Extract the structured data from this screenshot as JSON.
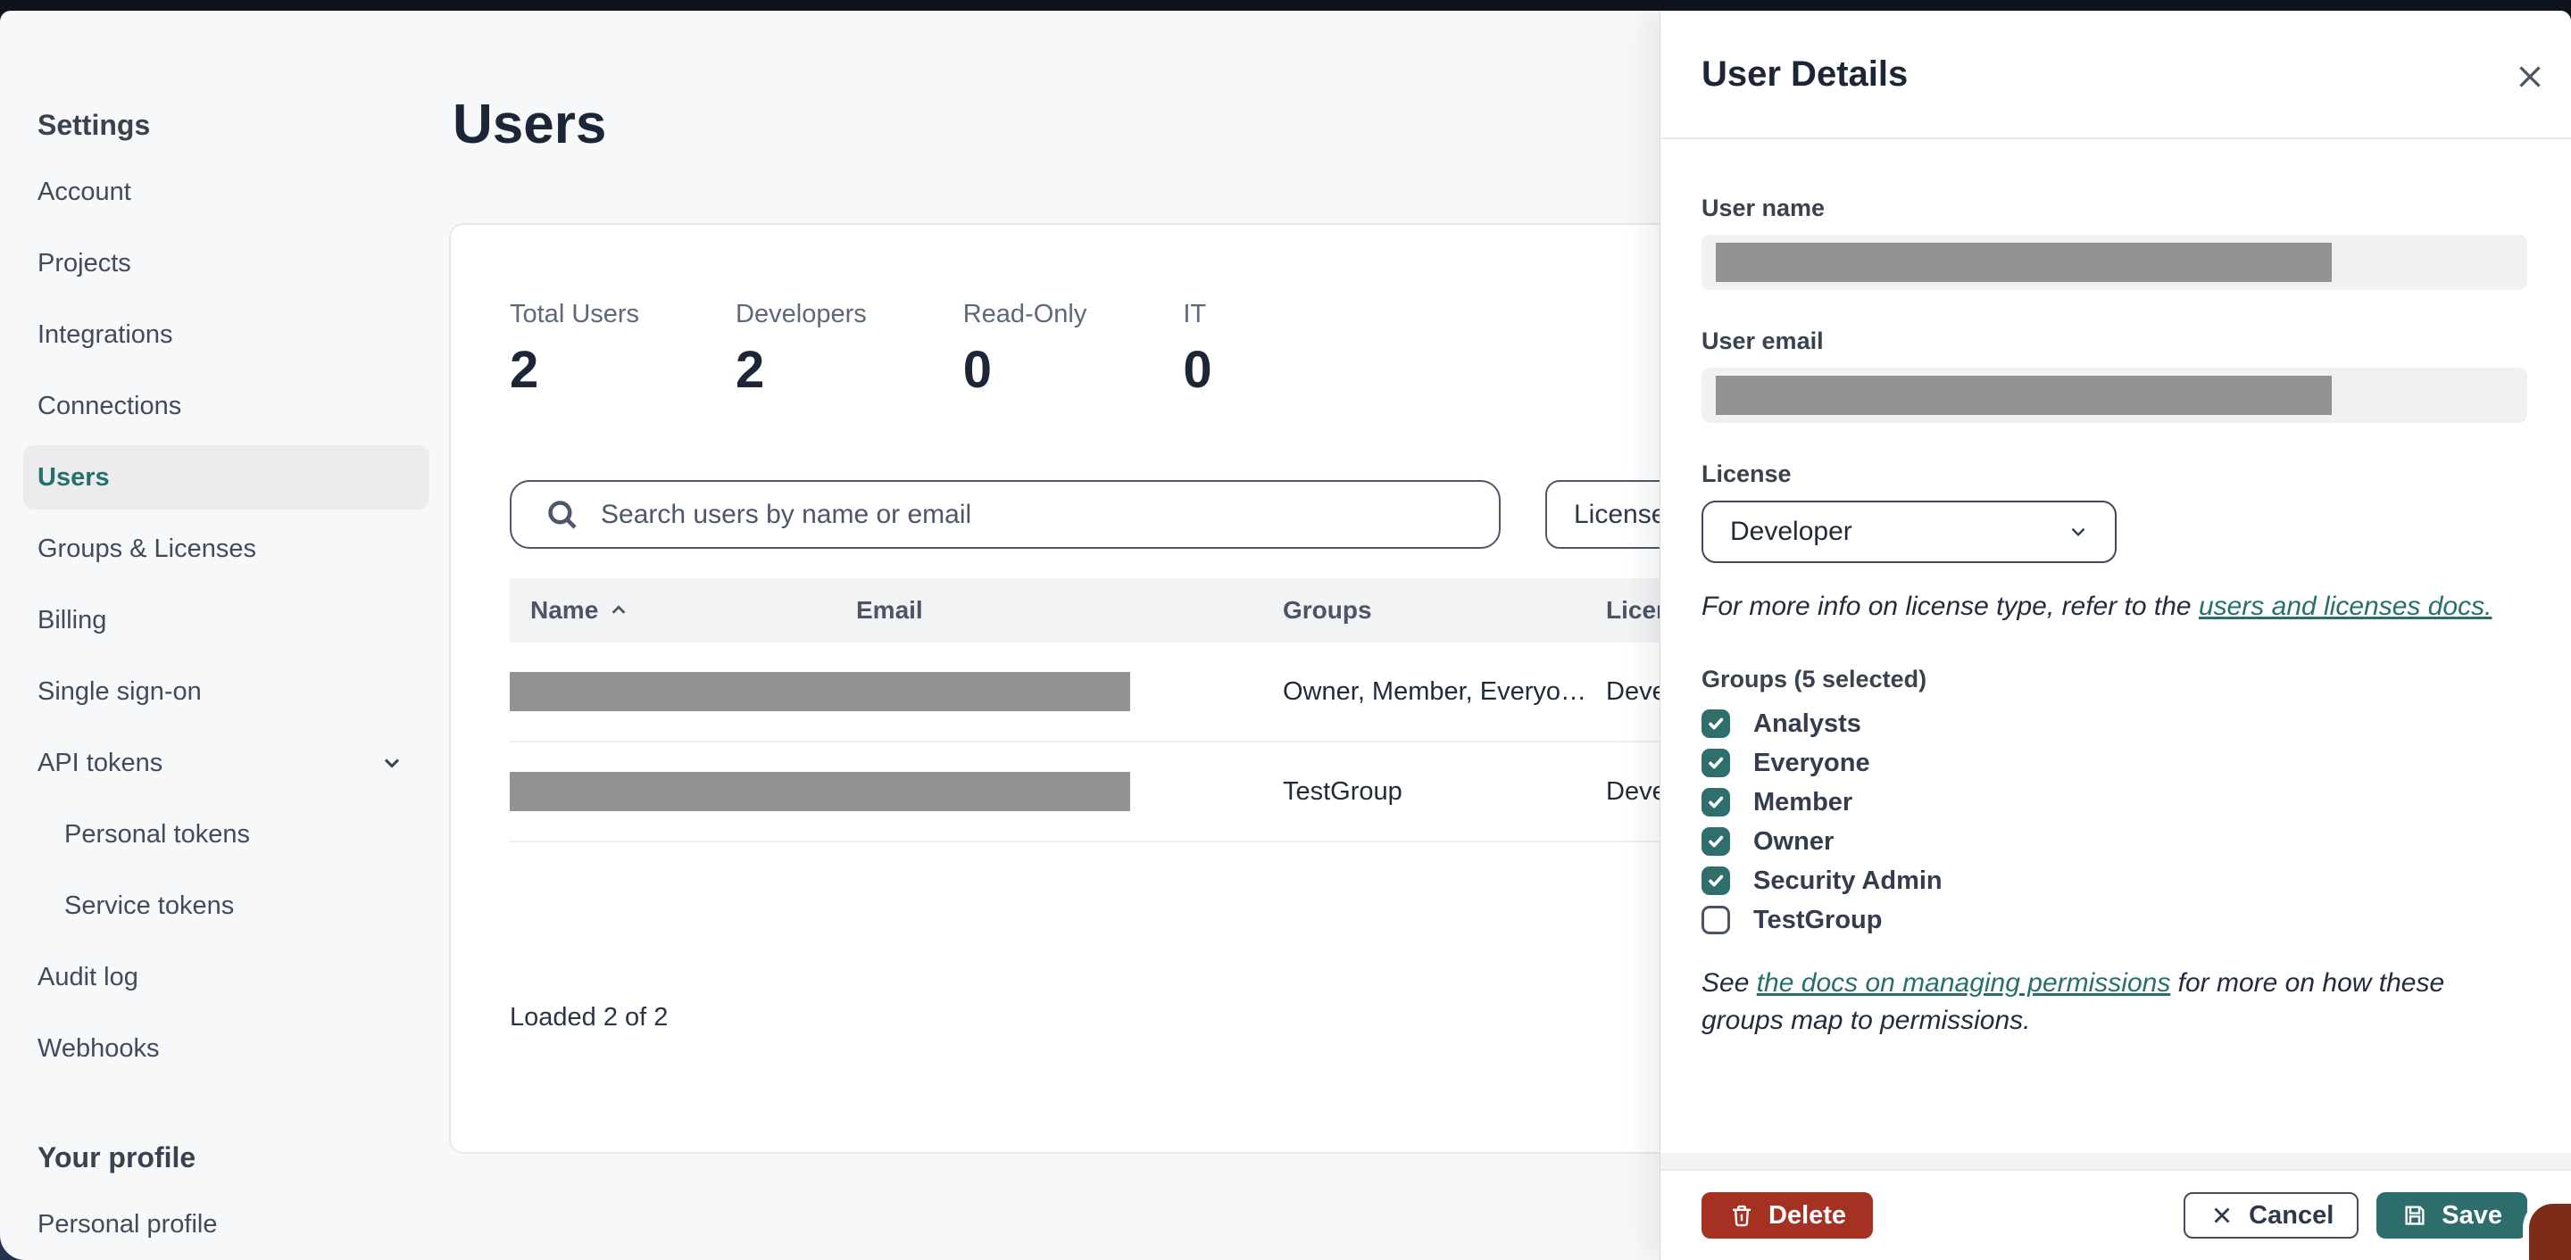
{
  "sidebar": {
    "heading": "Settings",
    "items": [
      {
        "label": "Account"
      },
      {
        "label": "Projects"
      },
      {
        "label": "Integrations"
      },
      {
        "label": "Connections"
      },
      {
        "label": "Users",
        "selected": true
      },
      {
        "label": "Groups & Licenses"
      },
      {
        "label": "Billing"
      },
      {
        "label": "Single sign-on"
      },
      {
        "label": "API tokens",
        "expandable": true
      },
      {
        "label": "Personal tokens",
        "indented": true
      },
      {
        "label": "Service tokens",
        "indented": true
      },
      {
        "label": "Audit log"
      },
      {
        "label": "Webhooks"
      }
    ],
    "profile_heading": "Your profile",
    "profile_items": [
      {
        "label": "Personal profile"
      }
    ]
  },
  "main": {
    "title": "Users",
    "stats": [
      {
        "label": "Total Users",
        "value": "2"
      },
      {
        "label": "Developers",
        "value": "2"
      },
      {
        "label": "Read-Only",
        "value": "0"
      },
      {
        "label": "IT",
        "value": "0"
      }
    ],
    "search": {
      "placeholder": "Search users by name or email"
    },
    "license_filter": {
      "label": "License"
    },
    "table": {
      "columns": [
        {
          "label": "Name",
          "sorted": "asc"
        },
        {
          "label": "Email"
        },
        {
          "label": "Groups"
        },
        {
          "label": "License"
        }
      ],
      "rows": [
        {
          "name_redacted": true,
          "email_redacted": true,
          "groups": "Owner, Member, Everyo…",
          "license": "Developer"
        },
        {
          "name_redacted": true,
          "email_redacted": true,
          "groups": "TestGroup",
          "license": "Developer"
        }
      ],
      "status": "Loaded 2 of 2"
    }
  },
  "panel": {
    "title": "User Details",
    "user_name_label": "User name",
    "user_email_label": "User email",
    "license_label": "License",
    "license_value": "Developer",
    "license_note": {
      "prefix": "For more info on license type, refer to the ",
      "link_text": "users and licenses docs."
    },
    "groups_label": "Groups (5 selected)",
    "groups": [
      {
        "label": "Analysts",
        "checked": true
      },
      {
        "label": "Everyone",
        "checked": true
      },
      {
        "label": "Member",
        "checked": true
      },
      {
        "label": "Owner",
        "checked": true
      },
      {
        "label": "Security Admin",
        "checked": true
      },
      {
        "label": "TestGroup",
        "checked": false
      }
    ],
    "permissions_note": {
      "prefix": "See ",
      "link_text": "the docs on managing permissions",
      "suffix": " for more on how these groups map to permissions."
    },
    "buttons": {
      "delete": "Delete",
      "cancel": "Cancel",
      "save": "Save"
    }
  },
  "colors": {
    "accent_teal": "#26706c",
    "save_teal": "#2d6e6c",
    "delete_red": "#a43122",
    "selected_item_bg": "#ececee",
    "redaction_gray": "#939393",
    "topbar": "#0e141e"
  }
}
